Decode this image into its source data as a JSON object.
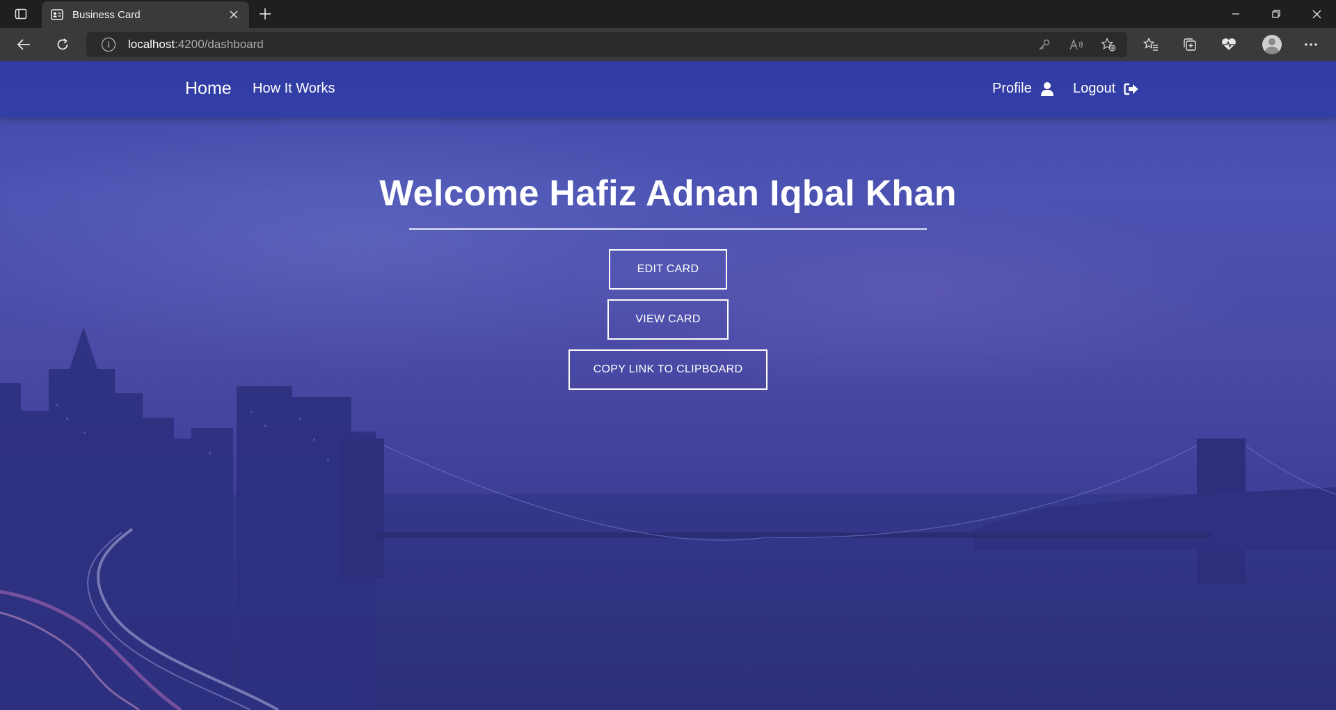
{
  "browser": {
    "tab_title": "Business Card",
    "url_host": "localhost",
    "url_rest": ":4200/dashboard"
  },
  "nav": {
    "home": "Home",
    "how_it_works": "How It Works",
    "profile": "Profile",
    "logout": "Logout"
  },
  "main": {
    "welcome": "Welcome Hafiz Adnan Iqbal Khan",
    "buttons": [
      "EDIT CARD",
      "VIEW CARD",
      "COPY LINK TO CLIPBOARD"
    ]
  },
  "colors": {
    "overlay": "#3f46a8",
    "text": "#ffffff"
  }
}
